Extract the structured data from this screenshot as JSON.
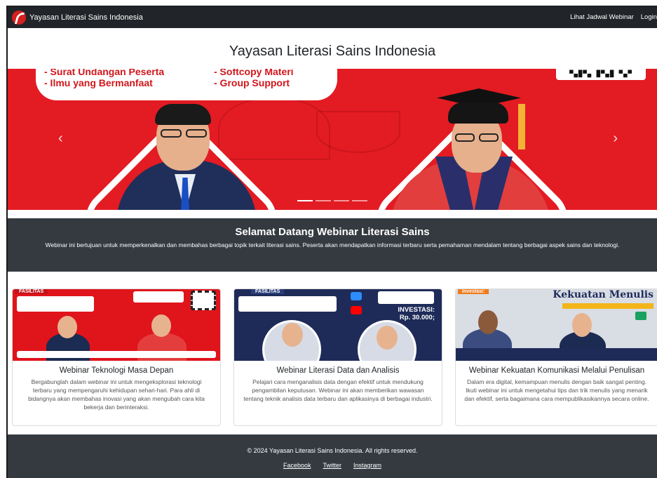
{
  "navbar": {
    "brand": "Yayasan Literasi Sains Indonesia",
    "links": [
      "Lihat Jadwal Webinar",
      "Login"
    ]
  },
  "site_title": "Yayasan Literasi Sains Indonesia",
  "carousel": {
    "banner_left": [
      "- Surat Undangan Peserta",
      "- Ilmu yang Bermanfaat"
    ],
    "banner_right": [
      "- Softcopy Materi",
      "- Group Support"
    ],
    "prev_glyph": "‹",
    "next_glyph": "›",
    "slide_count": 4,
    "active_slide": 1,
    "colors": {
      "background": "#e31b23",
      "accent": "#ffffff"
    }
  },
  "welcome": {
    "title": "Selamat Datang Webinar Literasi Sains",
    "text": "Webinar ini bertujuan untuk memperkenalkan dan membahas berbagai topik terkait literasi sains. Peserta akan mendapatkan informasi terbaru serta pemahaman mendalam tentang berbagai aspek sains dan teknologi."
  },
  "cards": [
    {
      "image_tag": "FASILITAS",
      "title": "Webinar Teknologi Masa Depan",
      "text": "Bergabunglah dalam webinar ini untuk mengeksplorasi teknologi terbaru yang mempengaruhi kehidupan sehari-hari. Para ahli di bidangnya akan membahas inovasi yang akan mengubah cara kita bekerja dan berinteraksi."
    },
    {
      "image_tag": "FASILITAS",
      "image_invest": "INVESTASI:\nRp. 30.000;",
      "title": "Webinar Literasi Data dan Analisis",
      "text": "Pelajari cara menganalisis data dengan efektif untuk mendukung pengambilan keputusan. Webinar ini akan memberikan wawasan tentang teknik analisis data terbaru dan aplikasinya di berbagai industri."
    },
    {
      "image_tag": "Investasi:",
      "image_header": "Kekuatan Menulis",
      "title": "Webinar Kekuatan Komunikasi Melalui Penulisan",
      "text": "Dalam era digital, kemampuan menulis dengan baik sangat penting. Ikuti webinar ini untuk mengetahui tips dan trik menulis yang menarik dan efektif, serta bagaimana cara mempublikasikannya secara online."
    }
  ],
  "footer": {
    "copyright": "© 2024 Yayasan Literasi Sains Indonesia. All rights reserved.",
    "links": [
      "Facebook",
      "Twitter",
      "Instagram"
    ]
  },
  "colors": {
    "navbar": "#212529",
    "section_dark": "#343a40",
    "brand_red": "#e31b23"
  }
}
